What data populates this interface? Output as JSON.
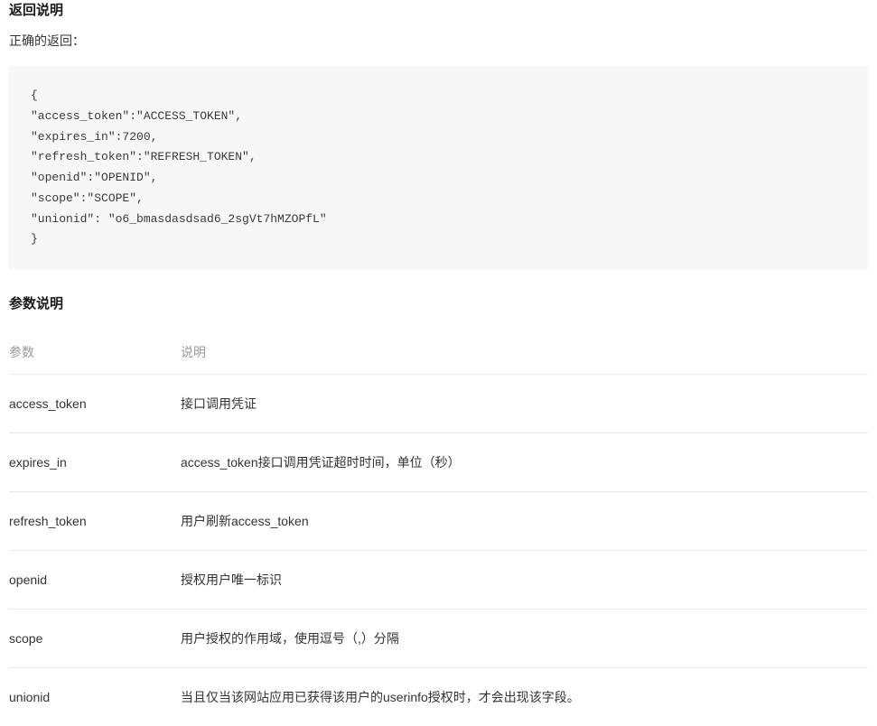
{
  "header": {
    "title": "返回说明",
    "subtitle": "正确的返回："
  },
  "code_block": "{\n\"access_token\":\"ACCESS_TOKEN\",\n\"expires_in\":7200,\n\"refresh_token\":\"REFRESH_TOKEN\",\n\"openid\":\"OPENID\",\n\"scope\":\"SCOPE\",\n\"unionid\": \"o6_bmasdasdsad6_2sgVt7hMZOPfL\"\n}",
  "params": {
    "title": "参数说明",
    "headers": {
      "param": "参数",
      "desc": "说明"
    },
    "rows": [
      {
        "param": "access_token",
        "desc": "接口调用凭证"
      },
      {
        "param": "expires_in",
        "desc": "access_token接口调用凭证超时时间，单位（秒）"
      },
      {
        "param": "refresh_token",
        "desc": "用户刷新access_token"
      },
      {
        "param": "openid",
        "desc": "授权用户唯一标识"
      },
      {
        "param": "scope",
        "desc": "用户授权的作用域，使用逗号（,）分隔"
      },
      {
        "param": "unionid",
        "desc": "当且仅当该网站应用已获得该用户的userinfo授权时，才会出现该字段。"
      }
    ]
  }
}
